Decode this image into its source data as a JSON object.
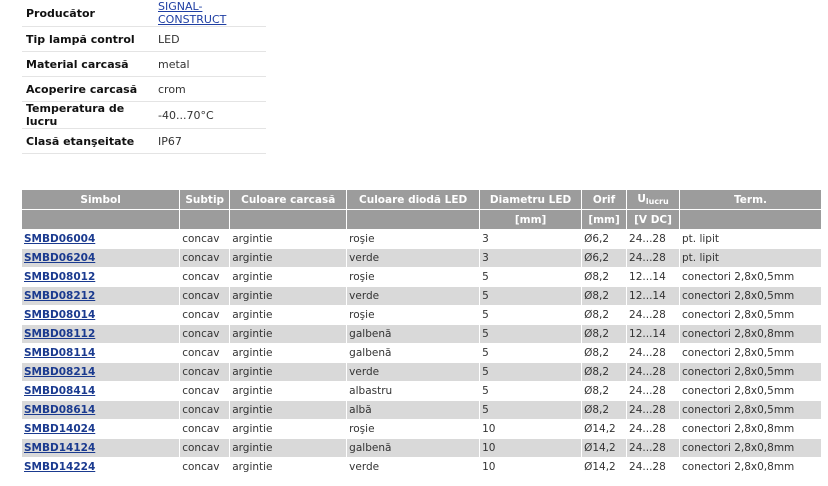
{
  "properties": [
    {
      "label": "Producător",
      "value": "SIGNAL-CONSTRUCT",
      "link": true
    },
    {
      "label": "Tip lampă control",
      "value": "LED"
    },
    {
      "label": "Material carcasă",
      "value": "metal"
    },
    {
      "label": "Acoperire carcasă",
      "value": "crom"
    },
    {
      "label": "Temperatura de lucru",
      "value": "-40...70°C"
    },
    {
      "label": "Clasă etanşeitate",
      "value": "IP67"
    }
  ],
  "table": {
    "headers": [
      "Simbol",
      "Subtip",
      "Culoare carcasă",
      "Culoare diodă LED",
      "Diametru LED",
      "Orif",
      "U",
      "Term."
    ],
    "u_subscript": "lucru",
    "units": [
      "",
      "",
      "",
      "",
      "[mm]",
      "[mm]",
      "[V DC]",
      ""
    ],
    "rows": [
      [
        "SMBD06004",
        "concav",
        "argintie",
        "roşie",
        "3",
        "Ø6,2",
        "24...28",
        "pt. lipit"
      ],
      [
        "SMBD06204",
        "concav",
        "argintie",
        "verde",
        "3",
        "Ø6,2",
        "24...28",
        "pt. lipit"
      ],
      [
        "SMBD08012",
        "concav",
        "argintie",
        "roşie",
        "5",
        "Ø8,2",
        "12...14",
        "conectori 2,8x0,5mm"
      ],
      [
        "SMBD08212",
        "concav",
        "argintie",
        "verde",
        "5",
        "Ø8,2",
        "12...14",
        "conectori 2,8x0,5mm"
      ],
      [
        "SMBD08014",
        "concav",
        "argintie",
        "roşie",
        "5",
        "Ø8,2",
        "24...28",
        "conectori 2,8x0,5mm"
      ],
      [
        "SMBD08112",
        "concav",
        "argintie",
        "galbenă",
        "5",
        "Ø8,2",
        "12...14",
        "conectori 2,8x0,8mm"
      ],
      [
        "SMBD08114",
        "concav",
        "argintie",
        "galbenă",
        "5",
        "Ø8,2",
        "24...28",
        "conectori 2,8x0,5mm"
      ],
      [
        "SMBD08214",
        "concav",
        "argintie",
        "verde",
        "5",
        "Ø8,2",
        "24...28",
        "conectori 2,8x0,5mm"
      ],
      [
        "SMBD08414",
        "concav",
        "argintie",
        "albastru",
        "5",
        "Ø8,2",
        "24...28",
        "conectori 2,8x0,5mm"
      ],
      [
        "SMBD08614",
        "concav",
        "argintie",
        "albă",
        "5",
        "Ø8,2",
        "24...28",
        "conectori 2,8x0,5mm"
      ],
      [
        "SMBD14024",
        "concav",
        "argintie",
        "roşie",
        "10",
        "Ø14,2",
        "24...28",
        "conectori 2,8x0,8mm"
      ],
      [
        "SMBD14124",
        "concav",
        "argintie",
        "galbenă",
        "10",
        "Ø14,2",
        "24...28",
        "conectori 2,8x0,8mm"
      ],
      [
        "SMBD14224",
        "concav",
        "argintie",
        "verde",
        "10",
        "Ø14,2",
        "24...28",
        "conectori 2,8x0,8mm"
      ]
    ]
  }
}
